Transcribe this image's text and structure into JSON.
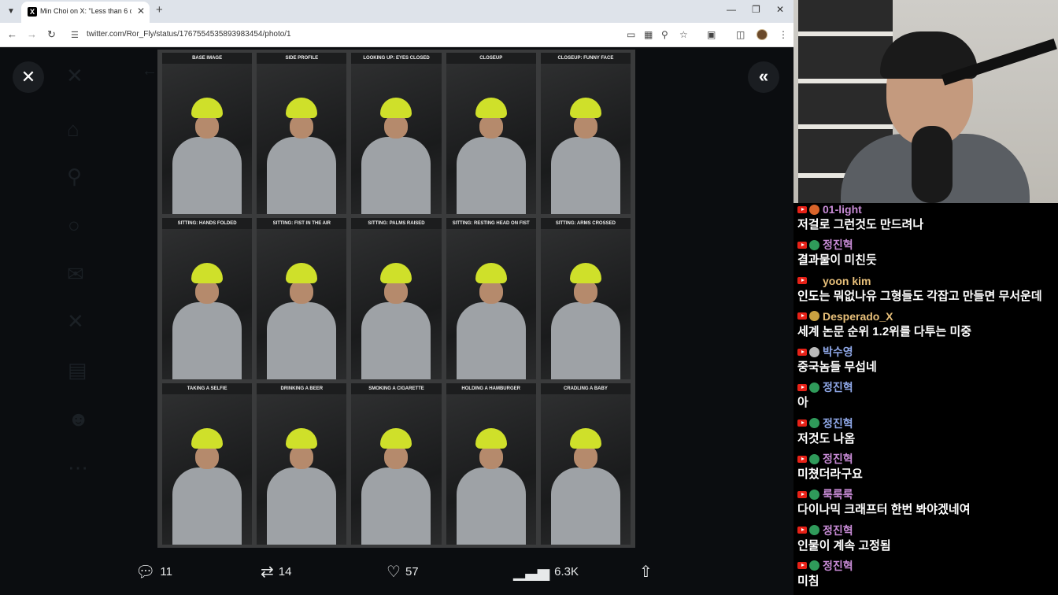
{
  "browser": {
    "tab_title": "Min Choi on X: \"Less than 6 d",
    "tab_favicon": "X",
    "url": "twitter.com/Ror_Fly/status/1767554535893983454/photo/1"
  },
  "photo": {
    "labels": [
      "BASE IMAGE",
      "SIDE PROFILE",
      "LOOKING UP: EYES CLOSED",
      "CLOSEUP",
      "CLOSEUP: FUNNY FACE",
      "SITTING: HANDS FOLDED",
      "SITTING: FIST IN THE AIR",
      "SITTING: PALMS RAISED",
      "SITTING: RESTING HEAD ON FIST",
      "SITTING: ARMS CROSSED",
      "TAKING A SELFIE",
      "DRINKING A BEER",
      "SMOKING A CIGARETTE",
      "HOLDING A HAMBURGER",
      "CRADLING A BABY"
    ],
    "colors": {
      "beanie": "#cfe02a",
      "hoodie": "#9ea2a6"
    }
  },
  "actions": {
    "replies": "11",
    "retweets": "14",
    "likes": "57",
    "views": "6.3K"
  },
  "chat": [
    {
      "user": "01-light",
      "color": "#c88bd6",
      "badge": "#d9642a",
      "text": "저걸로 그런것도 만드려나"
    },
    {
      "user": "정진혁",
      "color": "#c88bd6",
      "badge": "#2f9a5a",
      "text": "결과물이 미친듯"
    },
    {
      "user": "yoon kim",
      "color": "#e8c07a",
      "badge": "#000000",
      "text": "인도는 뭐없나유 그형들도 각잡고 만들면 무서운데"
    },
    {
      "user": "Desperado_X",
      "color": "#e8c07a",
      "badge": "#c8a040",
      "text": "세계 논문 순위 1.2위를 다투는 미중"
    },
    {
      "user": "박수영",
      "color": "#8fa8e8",
      "badge": "#bbbbbb",
      "text": "중국놈들 무섭네"
    },
    {
      "user": "정진혁",
      "color": "#8fa8e8",
      "badge": "#2f9a5a",
      "text": "아"
    },
    {
      "user": "정진혁",
      "color": "#8fa8e8",
      "badge": "#2f9a5a",
      "text": "저것도 나옴"
    },
    {
      "user": "정진혁",
      "color": "#c88bd6",
      "badge": "#2f9a5a",
      "text": "미쳤더라구요"
    },
    {
      "user": "룩룩룩",
      "color": "#c88bd6",
      "badge": "#2f9a5a",
      "text": "다이나믹 크래프터 한번 봐야겠네여"
    },
    {
      "user": "정진혁",
      "color": "#c88bd6",
      "badge": "#2f9a5a",
      "text": "인물이 계속 고정됨"
    },
    {
      "user": "정진혁",
      "color": "#c88bd6",
      "badge": "#2f9a5a",
      "text": "미침"
    }
  ]
}
